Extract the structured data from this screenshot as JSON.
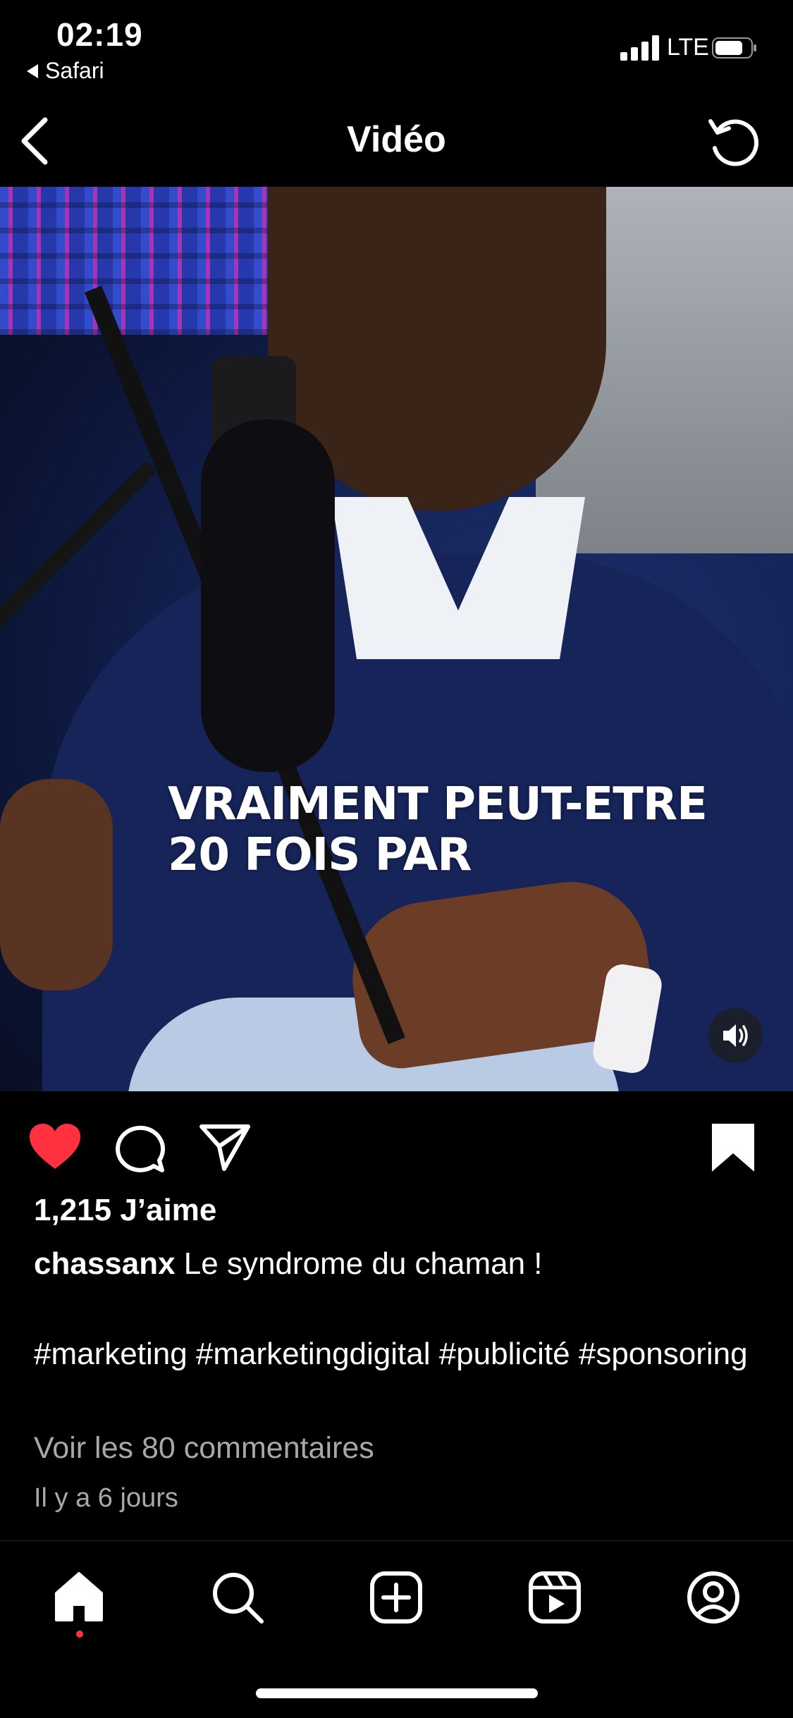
{
  "status_bar": {
    "time": "02:19",
    "back_app": "Safari",
    "network": "LTE"
  },
  "nav": {
    "title": "Vidéo",
    "back_icon": "chevron-left-icon",
    "refresh_icon": "refresh-icon"
  },
  "video": {
    "caption_line1": "VRAIMENT PEUT-ETRE",
    "caption_line2": "20 FOIS PAR",
    "sound_icon": "speaker-icon"
  },
  "actions": {
    "like_icon": "heart-icon",
    "comment_icon": "comment-icon",
    "share_icon": "paper-plane-icon",
    "save_icon": "bookmark-icon",
    "like_color": "#ff3040"
  },
  "post": {
    "likes": "1,215 J’aime",
    "username": "chassanx",
    "caption": " Le syndrome du chaman !",
    "hashtags": "#marketing #marketingdigital #publicité #sponsoring",
    "comments_link": "Voir les 80 commentaires",
    "time_ago": "Il y a 6 jours"
  },
  "tabbar": {
    "home_icon": "home-icon",
    "search_icon": "search-icon",
    "create_icon": "plus-square-icon",
    "reels_icon": "reels-icon",
    "profile_icon": "profile-icon"
  }
}
